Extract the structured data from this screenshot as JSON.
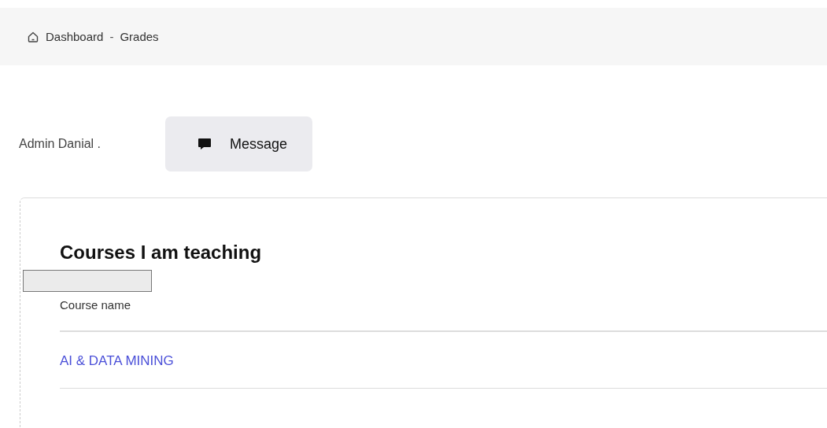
{
  "breadcrumb": {
    "items": [
      "Dashboard",
      "Grades"
    ],
    "separator": "-"
  },
  "user": {
    "name": "Admin Danial .",
    "button": "Message"
  },
  "card": {
    "title": "Courses I am teaching",
    "table": {
      "columns": [
        "Course name"
      ],
      "rows": [
        [
          "AI & DATA MINING"
        ]
      ]
    }
  }
}
